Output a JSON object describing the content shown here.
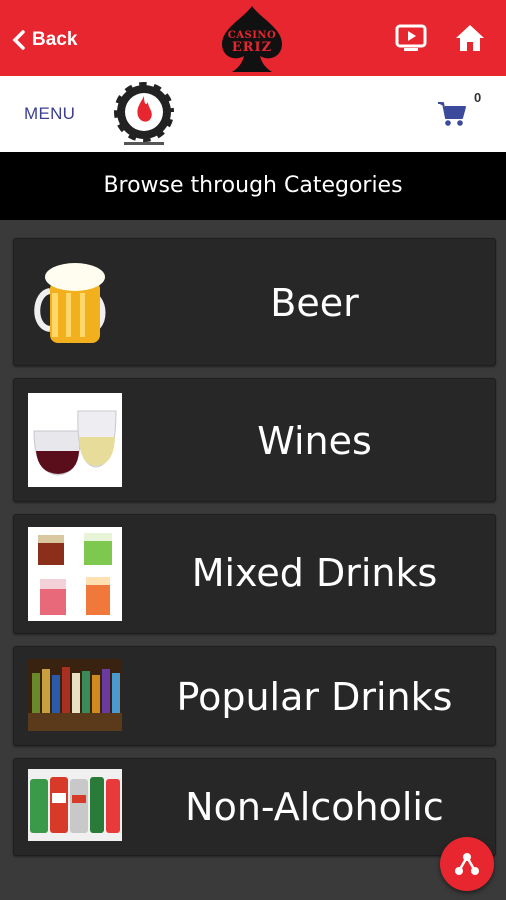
{
  "topbar": {
    "back_label": "Back",
    "logo_text_top": "CASINO",
    "logo_text_bottom": "ERIZ",
    "icons": [
      "chevron-left-icon",
      "spade-logo",
      "tv-play-icon",
      "home-icon"
    ],
    "color": "#e8262f"
  },
  "header": {
    "menu_label": "MENU",
    "cart_count": "0",
    "icons": [
      "poker-chip-logo",
      "cart-icon"
    ]
  },
  "banner": {
    "title": "Browse through Categories"
  },
  "categories": [
    {
      "label": "Beer",
      "icon": "beer-mug-image"
    },
    {
      "label": "Wines",
      "icon": "wine-glasses-image"
    },
    {
      "label": "Mixed Drinks",
      "icon": "cocktails-image"
    },
    {
      "label": "Popular Drinks",
      "icon": "bottles-image"
    },
    {
      "label": "Non-Alcoholic",
      "icon": "soda-cans-image"
    }
  ],
  "fab": {
    "icon": "share-nodes-icon"
  }
}
